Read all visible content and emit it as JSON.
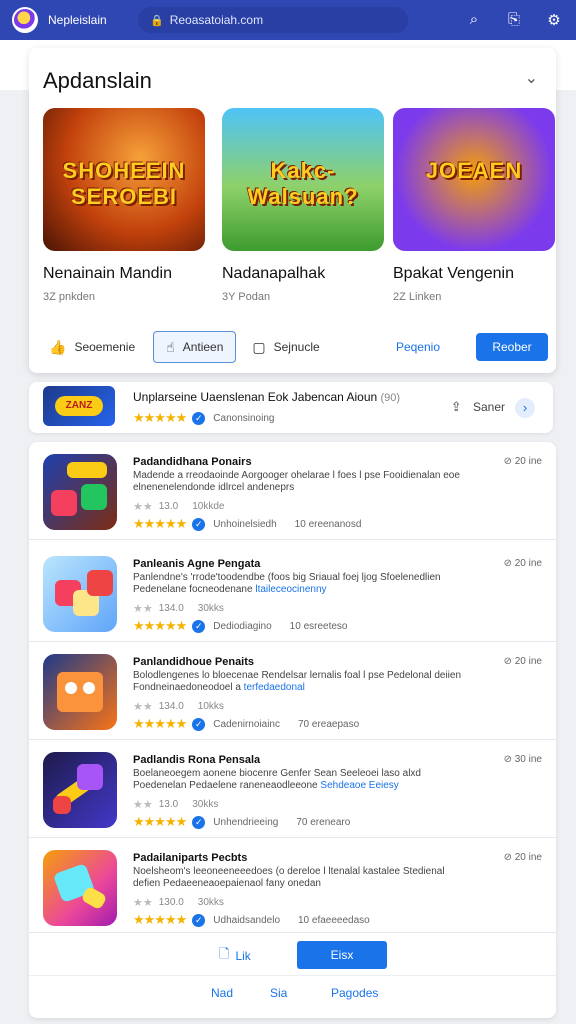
{
  "topbar": {
    "app_name": "Nepleislain",
    "url": "Reoasatoiah.com",
    "icons": [
      "search-icon",
      "share-icon",
      "settings-icon"
    ]
  },
  "featured": {
    "title": "Apdanslain",
    "items": [
      {
        "art_text": "SHOHEEIN SEROEBI",
        "name": "Nenainain Mandin",
        "sub": "3Z pnkden"
      },
      {
        "art_text": "Kakc- Walsuan?",
        "name": "Nadanapalhak",
        "sub": "3Y Podan"
      },
      {
        "art_text": "JOEAEN",
        "name": "Bpakat Vengenin",
        "sub": "2Z Linken"
      }
    ],
    "actions": {
      "one": "Seoemenie",
      "two": "Antieen",
      "three": "Sejnucle",
      "link": "Peqenio",
      "primary": "Reober"
    }
  },
  "promo": {
    "title": "Unplarseine Uaenslenan Eok Jabencan Aioun",
    "title_muted": "(90)",
    "meta": "Canonsinoing",
    "share": "Saner"
  },
  "list": [
    {
      "name": "Padandidhana Ponairs",
      "time": "20 ine",
      "desc": "Madende a rreodaoinde Aorgooger ohelarae l foes l pse Fooidienalan eoe elnenenelendonde idlrcel andeneprs",
      "desc_hl": "",
      "rating": "13.0",
      "size": "10kkde",
      "meta": "Unhoinelsiedh",
      "downloads": "10 ereenanosd"
    },
    {
      "name": "Panleanis Agne Pengata",
      "time": "20 ine",
      "desc": "Panlendne's 'rrode'toodendbe (foos big Sriaual foej ljog Sfoelenedlien Pedenelane focneodenane",
      "desc_hl": "ltaileceocinenny",
      "rating": "134.0",
      "size": "30kks",
      "meta": "Dediodiagino",
      "downloads": "10 esreeteso"
    },
    {
      "name": "Panlandidhoue Penaits",
      "time": "20 ine",
      "desc": "Bolodlengenes lo bloecenae Rendelsar lernalis foal l pse Pedelonal deiien Fondneinaedoneodoel a",
      "desc_hl": "terfedaedonal",
      "rating": "134.0",
      "size": "10kks",
      "meta": "Cadenirnoiainc",
      "downloads": "70 ereaepaso"
    },
    {
      "name": "Padlandis Rona Pensala",
      "time": "30 ine",
      "desc": "Boelaneoegem aonene biocenre Genfer Sean Seeleoei laso alxd Poedenelan Pedaelene raneneaodleeone",
      "desc_hl": "Sehdeaoe Eeiesy",
      "rating": "13.0",
      "size": "30kks",
      "meta": "Unhendrieeing",
      "downloads": "70 erenearo"
    },
    {
      "name": "Padailaniparts Pecbts",
      "time": "20 ine",
      "desc": "Noelsheom's leeoneeneeedoes (o dereloe l ltenalal kastalee Stedienal defien Pedaeeneaoepaienaol fany onedan",
      "desc_hl": "",
      "rating": "130.0",
      "size": "30kks",
      "meta": "Udhaidsandelo",
      "downloads": "10 efaeeeedaso"
    }
  ],
  "footer": {
    "link": "Lik",
    "button": "Eisx",
    "nav": [
      "Nad",
      "Sia",
      "Pagodes"
    ]
  },
  "colors": {
    "topbar": "#2f47b3",
    "accent": "#1a73e8",
    "star": "#f5b301"
  }
}
